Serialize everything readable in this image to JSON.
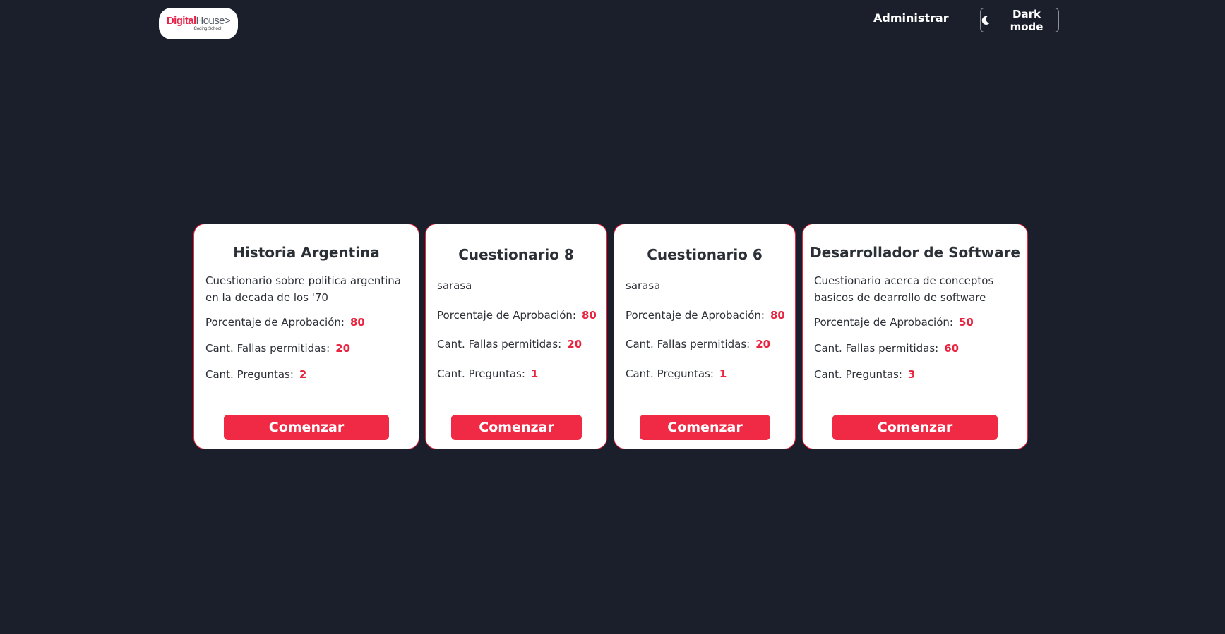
{
  "header": {
    "logo": {
      "brand_red": "Digital",
      "brand_grey": "House",
      "arrow": ">",
      "tagline": "Coding School"
    },
    "admin_link": "Administrar",
    "dark_mode_button": {
      "label": "Dark mode",
      "icon": "moon-icon"
    }
  },
  "colors": {
    "background": "#1b1f2b",
    "accent": "#f02a44",
    "card_bg": "#ffffff",
    "text": "#2b2f36"
  },
  "labels": {
    "approval": "Porcentaje de Aprobación:",
    "failures": "Cant. Fallas permitidas:",
    "questions": "Cant. Preguntas:",
    "start": "Comenzar"
  },
  "quizzes": [
    {
      "title": "Historia Argentina",
      "description": "Cuestionario sobre politica argentina en la decada de los '70",
      "approval": "80",
      "failures": "20",
      "questions": "2"
    },
    {
      "title": "Cuestionario 8",
      "description": "sarasa",
      "approval": "80",
      "failures": "20",
      "questions": "1"
    },
    {
      "title": "Cuestionario 6",
      "description": "sarasa",
      "approval": "80",
      "failures": "20",
      "questions": "1"
    },
    {
      "title": "Desarrollador de Software",
      "description": "Cuestionario acerca de conceptos basicos de dearrollo de software",
      "approval": "50",
      "failures": "60",
      "questions": "3"
    }
  ]
}
